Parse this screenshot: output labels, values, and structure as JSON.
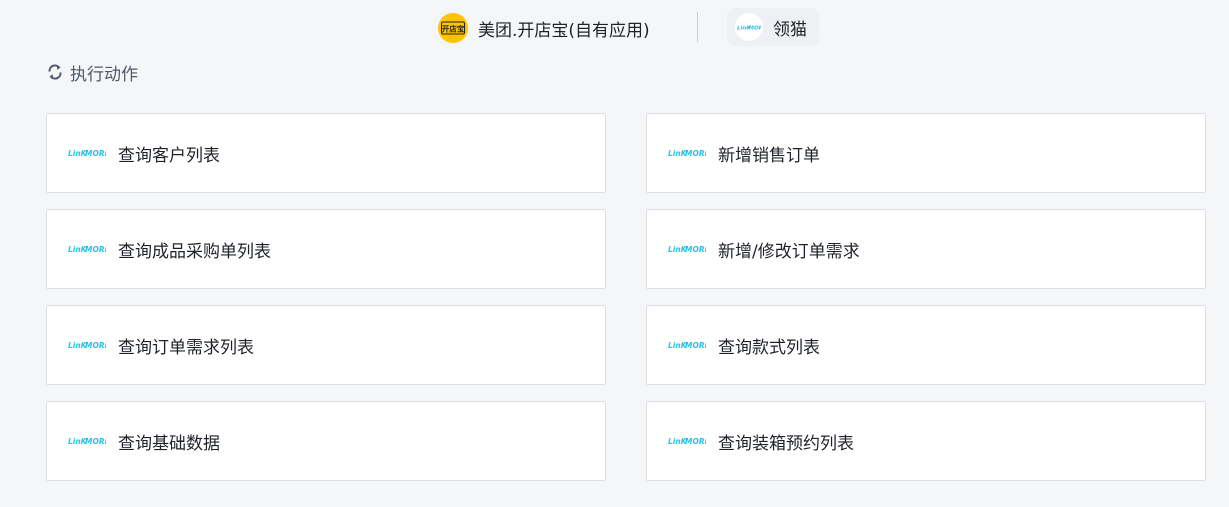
{
  "connector": {
    "source_app": "美团.开店宝(自有应用)",
    "source_logo_icon": "kaidianbao-logo-icon",
    "source_logo_text": "开店宝",
    "target_app": "领猫",
    "target_logo_icon": "linkmore-logo-icon",
    "brand_yellow": "#ffc300",
    "brand_cyan": "#29c3e6"
  },
  "section": {
    "icon": "refresh-icon",
    "title": "执行动作"
  },
  "logo_wordmark": {
    "part1": "LinK",
    "part2": "MORE"
  },
  "actions": [
    {
      "label": "查询客户列表"
    },
    {
      "label": "新增销售订单"
    },
    {
      "label": "查询成品采购单列表"
    },
    {
      "label": "新增/修改订单需求"
    },
    {
      "label": "查询订单需求列表"
    },
    {
      "label": "查询款式列表"
    },
    {
      "label": "查询基础数据"
    },
    {
      "label": "查询装箱预约列表"
    }
  ]
}
